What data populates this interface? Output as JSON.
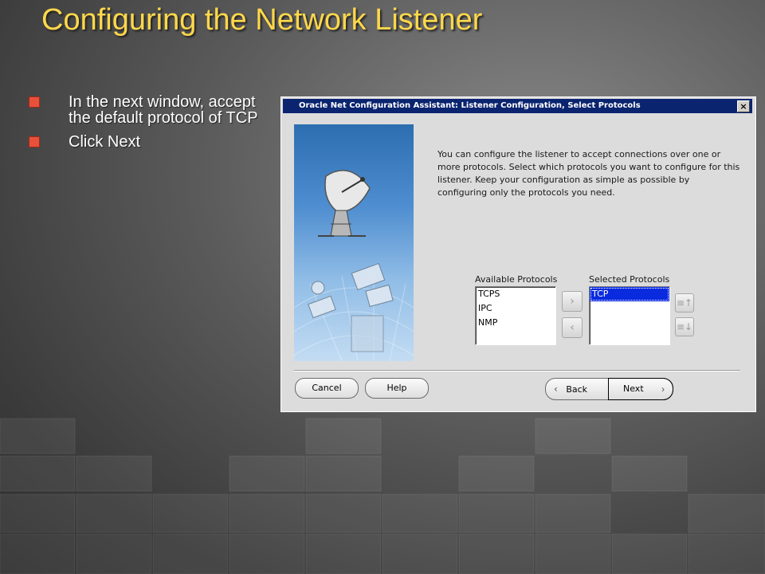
{
  "slide": {
    "title": "Configuring the Network Listener",
    "bullets": [
      "In the next window, accept the default protocol of TCP",
      "Click Next"
    ]
  },
  "dialog": {
    "title": "Oracle Net Configuration Assistant: Listener Configuration, Select Protocols",
    "close_label": "×",
    "description": "You can configure the listener to accept connections over one or more protocols. Select which protocols you want to configure for this listener. Keep your configuration as simple as possible by configuring only the protocols you need.",
    "available_label": "Available Protocols",
    "available_items": [
      "TCPS",
      "IPC",
      "NMP"
    ],
    "selected_label": "Selected Protocols",
    "selected_items": [
      "TCP"
    ],
    "buttons": {
      "cancel": "Cancel",
      "help": "Help",
      "back": "Back",
      "next": "Next"
    },
    "icons": {
      "add": "chevron-right-icon",
      "remove": "chevron-left-icon",
      "move_up": "move-up-icon",
      "move_down": "move-down-icon"
    },
    "colors": {
      "titlebar": "#0a2470",
      "selection": "#0a2ae0",
      "slide_title": "#ffd84a",
      "bullet": "#e8503a"
    }
  }
}
